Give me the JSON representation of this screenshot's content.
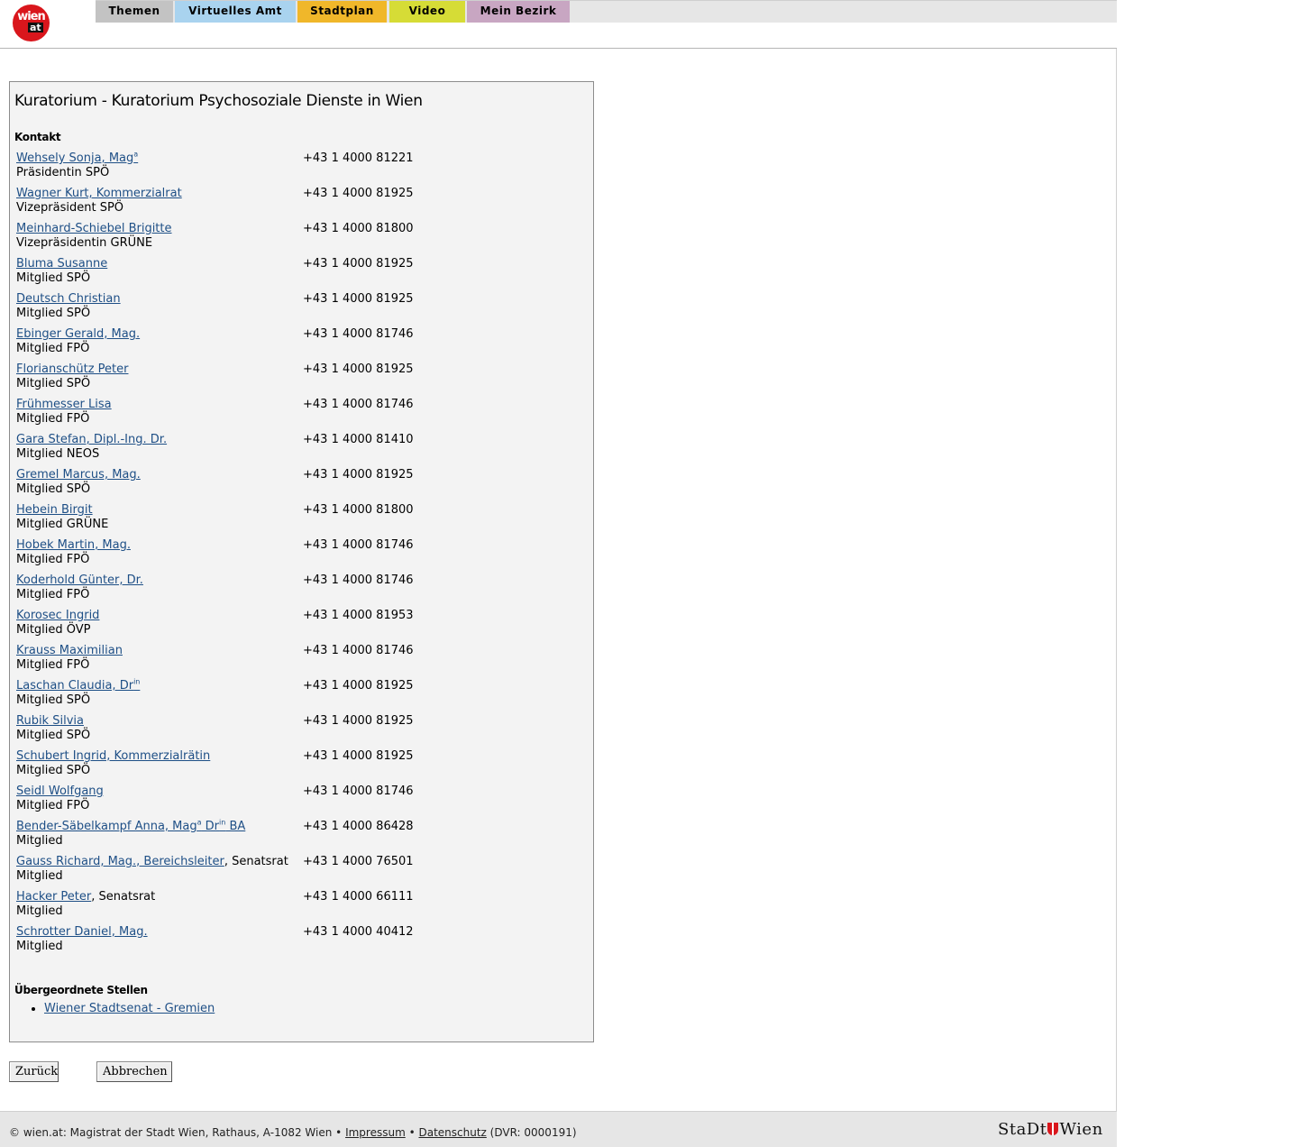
{
  "header": {
    "logo_text": "wien",
    "logo_sub": "at",
    "nav": [
      {
        "label": "Themen",
        "color": "#c3c3c3"
      },
      {
        "label": "Virtuelles Amt",
        "color": "#a9d3ef"
      },
      {
        "label": "Stadtplan",
        "color": "#f0b72a"
      },
      {
        "label": "Video",
        "color": "#d6dc36"
      },
      {
        "label": "Mein Bezirk",
        "color": "#c8a6c2"
      }
    ]
  },
  "main": {
    "title": "Kuratorium - Kuratorium Psychosoziale Dienste in Wien",
    "contact_label": "Kontakt",
    "contacts": [
      {
        "name": "Wehsely Sonja, Mag",
        "sup": "a",
        "suffix": "",
        "role": "Präsidentin SPÖ",
        "phone": "+43 1 4000 81221"
      },
      {
        "name": "Wagner Kurt, Kommerzialrat",
        "sup": "",
        "suffix": "",
        "role": "Vizepräsident SPÖ",
        "phone": "+43 1 4000 81925"
      },
      {
        "name": "Meinhard-Schiebel Brigitte",
        "sup": "",
        "suffix": "",
        "role": "Vizepräsidentin GRÜNE",
        "phone": "+43 1 4000 81800"
      },
      {
        "name": "Bluma Susanne",
        "sup": "",
        "suffix": "",
        "role": "Mitglied SPÖ",
        "phone": "+43 1 4000 81925"
      },
      {
        "name": "Deutsch Christian",
        "sup": "",
        "suffix": "",
        "role": "Mitglied SPÖ",
        "phone": "+43 1 4000 81925"
      },
      {
        "name": "Ebinger Gerald, Mag.",
        "sup": "",
        "suffix": "",
        "role": "Mitglied FPÖ",
        "phone": "+43 1 4000 81746"
      },
      {
        "name": "Florianschütz Peter",
        "sup": "",
        "suffix": "",
        "role": "Mitglied SPÖ",
        "phone": "+43 1 4000 81925"
      },
      {
        "name": "Frühmesser Lisa",
        "sup": "",
        "suffix": "",
        "role": "Mitglied FPÖ",
        "phone": "+43 1 4000 81746"
      },
      {
        "name": "Gara Stefan, Dipl.-Ing. Dr.",
        "sup": "",
        "suffix": "",
        "role": "Mitglied NEOS",
        "phone": "+43 1 4000 81410"
      },
      {
        "name": "Gremel Marcus, Mag.",
        "sup": "",
        "suffix": "",
        "role": "Mitglied SPÖ",
        "phone": "+43 1 4000 81925"
      },
      {
        "name": "Hebein Birgit",
        "sup": "",
        "suffix": "",
        "role": "Mitglied GRÜNE",
        "phone": "+43 1 4000 81800"
      },
      {
        "name": "Hobek Martin, Mag.",
        "sup": "",
        "suffix": "",
        "role": "Mitglied FPÖ",
        "phone": "+43 1 4000 81746"
      },
      {
        "name": "Koderhold Günter, Dr.",
        "sup": "",
        "suffix": "",
        "role": "Mitglied FPÖ",
        "phone": "+43 1 4000 81746"
      },
      {
        "name": "Korosec Ingrid",
        "sup": "",
        "suffix": "",
        "role": "Mitglied ÖVP",
        "phone": "+43 1 4000 81953"
      },
      {
        "name": "Krauss Maximilian",
        "sup": "",
        "suffix": "",
        "role": "Mitglied FPÖ",
        "phone": "+43 1 4000 81746"
      },
      {
        "name": "Laschan Claudia, Dr",
        "sup": "in",
        "suffix": "",
        "role": "Mitglied SPÖ",
        "phone": "+43 1 4000 81925"
      },
      {
        "name": "Rubik Silvia",
        "sup": "",
        "suffix": "",
        "role": "Mitglied SPÖ",
        "phone": "+43 1 4000 81925"
      },
      {
        "name": "Schubert Ingrid, Kommerzialrätin",
        "sup": "",
        "suffix": "",
        "role": "Mitglied SPÖ",
        "phone": "+43 1 4000 81925"
      },
      {
        "name": "Seidl Wolfgang",
        "sup": "",
        "suffix": "",
        "role": "Mitglied FPÖ",
        "phone": "+43 1 4000 81746"
      },
      {
        "name": "Bender-Säbelkampf Anna, Mag",
        "sup": "a",
        "name2": " Dr",
        "sup2": "in",
        "name3": " BA",
        "suffix": "",
        "role": "Mitglied",
        "phone": "+43 1 4000 86428"
      },
      {
        "name": "Gauss Richard, Mag., Bereichsleiter",
        "sup": "",
        "suffix": ", Senatsrat",
        "role": "Mitglied",
        "phone": "+43 1 4000 76501"
      },
      {
        "name": "Hacker Peter",
        "sup": "",
        "suffix": ", Senatsrat",
        "role": "Mitglied",
        "phone": "+43 1 4000 66111"
      },
      {
        "name": "Schrotter Daniel, Mag.",
        "sup": "",
        "suffix": "",
        "role": "Mitglied",
        "phone": "+43 1 4000 40412"
      }
    ],
    "parent_label": "Übergeordnete Stellen",
    "parents": [
      "Wiener Stadtsenat - Gremien"
    ]
  },
  "buttons": {
    "back": "Zurück",
    "cancel": "Abbrechen"
  },
  "footer": {
    "prefix": "© wien.at: Magistrat der Stadt Wien, Rathaus, A-1082 Wien • ",
    "impressum": "Impressum",
    "sep": " • ",
    "datenschutz": "Datenschutz",
    "dvr": " (DVR: 0000191)",
    "logo_left": "StaDt",
    "logo_right": "Wien"
  }
}
